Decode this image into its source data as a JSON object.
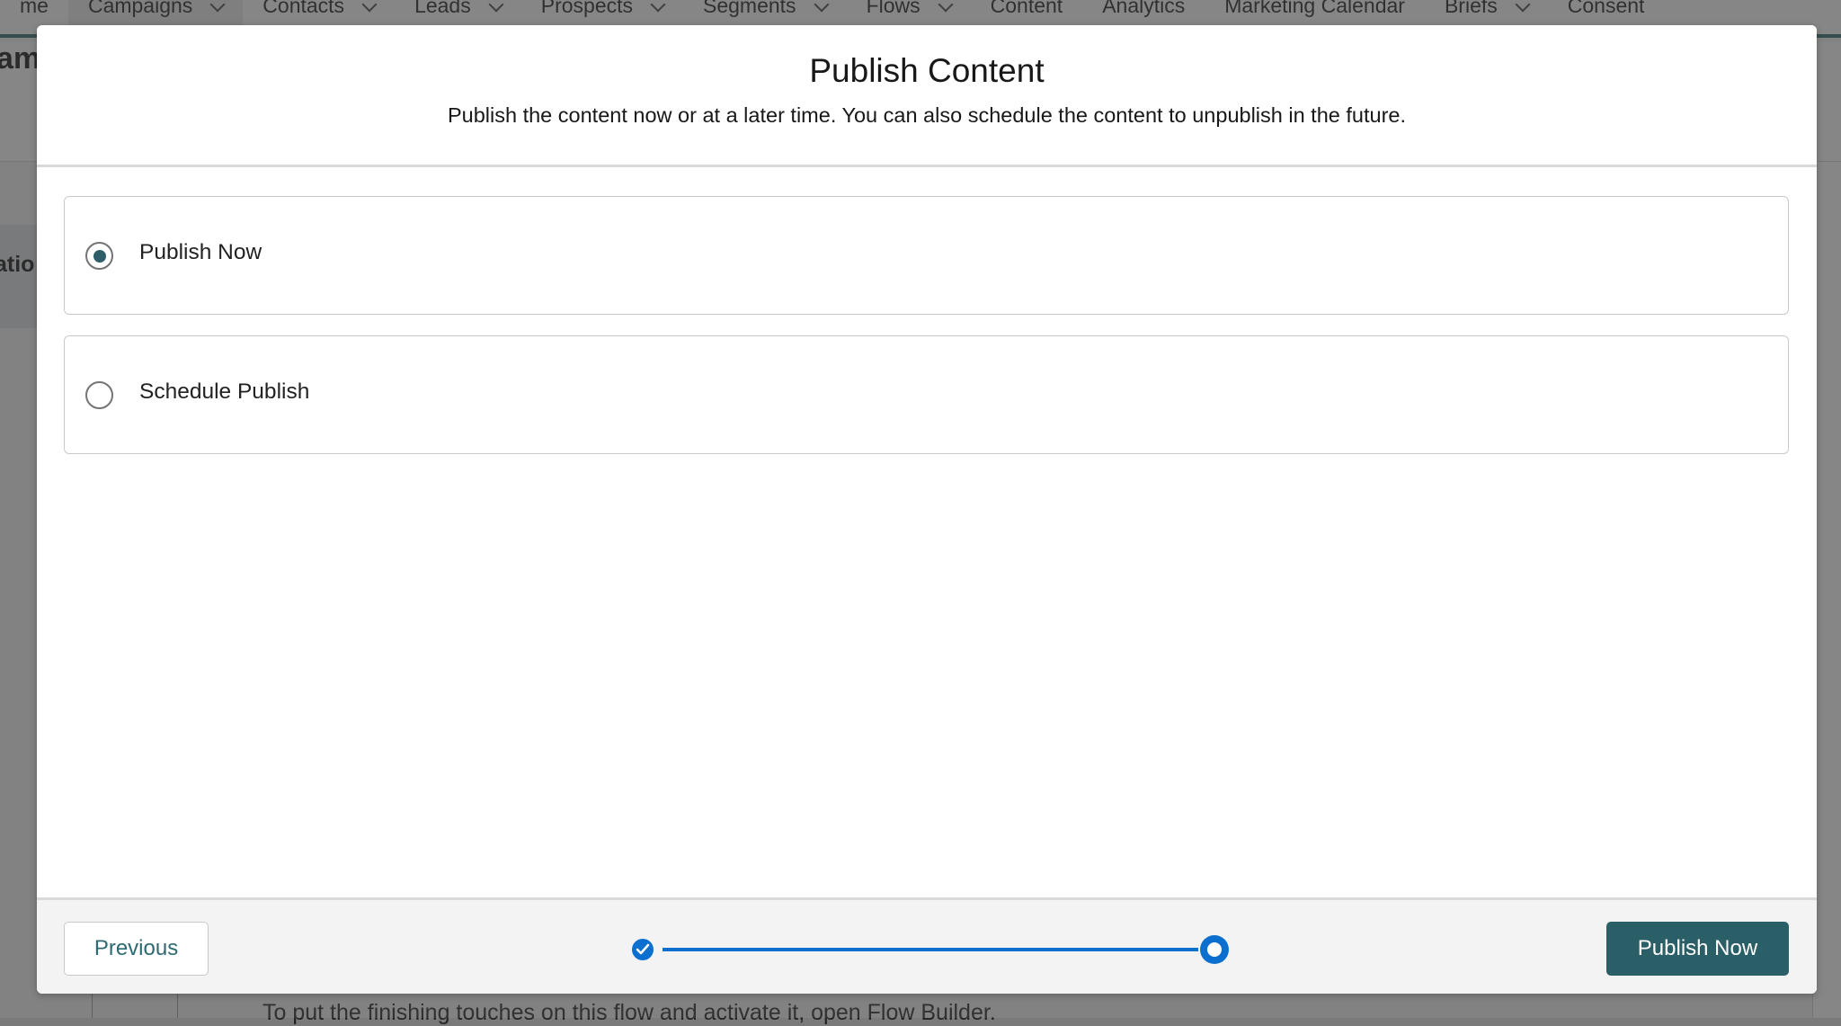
{
  "background": {
    "nav_items": [
      {
        "label": "me",
        "has_chevron": false,
        "active": false
      },
      {
        "label": "Campaigns",
        "has_chevron": true,
        "active": true
      },
      {
        "label": "Contacts",
        "has_chevron": true,
        "active": false
      },
      {
        "label": "Leads",
        "has_chevron": true,
        "active": false
      },
      {
        "label": "Prospects",
        "has_chevron": true,
        "active": false
      },
      {
        "label": "Segments",
        "has_chevron": true,
        "active": false
      },
      {
        "label": "Flows",
        "has_chevron": true,
        "active": false
      },
      {
        "label": "Content",
        "has_chevron": false,
        "active": false
      },
      {
        "label": "Analytics",
        "has_chevron": false,
        "active": false
      },
      {
        "label": "Marketing Calendar",
        "has_chevron": false,
        "active": false
      },
      {
        "label": "Briefs",
        "has_chevron": true,
        "active": false
      },
      {
        "label": "Consent",
        "has_chevron": false,
        "active": false
      }
    ],
    "page_title_fragment": "am",
    "side_label_fragment": "atio",
    "footer_text": "To put the finishing touches on this flow and activate it, open Flow Builder."
  },
  "modal": {
    "title": "Publish Content",
    "subtitle": "Publish the content now or at a later time. You can also schedule the content to unpublish in the future.",
    "options": [
      {
        "label": "Publish Now",
        "selected": true
      },
      {
        "label": "Schedule Publish",
        "selected": false
      }
    ],
    "footer": {
      "previous_label": "Previous",
      "primary_label": "Publish Now",
      "progress_steps": [
        {
          "state": "complete",
          "icon": "check-icon"
        },
        {
          "state": "current",
          "icon": "circle-icon"
        }
      ]
    }
  },
  "colors": {
    "brand_teal": "#2b5f68",
    "progress_blue": "#0b6fd0"
  }
}
